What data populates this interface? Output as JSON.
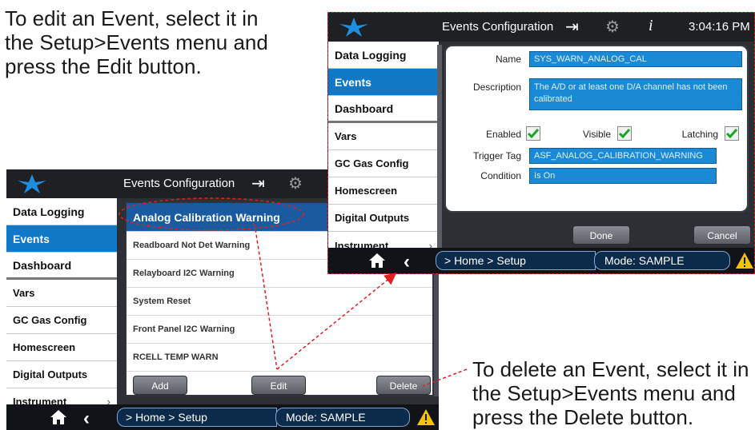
{
  "captions": {
    "edit": [
      "To edit an Event, select it in",
      "the Setup>Events menu and",
      "press the Edit button."
    ],
    "delete": [
      "To delete an Event, select it in",
      "the Setup>Events menu and",
      "press the Delete button."
    ]
  },
  "colors": {
    "accent": "#1178c8",
    "selected_row": "#1a5aa0",
    "field": "#1b8ad6",
    "annotation": "#e02020"
  },
  "left_screen": {
    "title": "Events Configuration",
    "sidebar": [
      "Data Logging",
      "Events",
      "Dashboard",
      "Vars",
      "GC Gas Config",
      "Homescreen",
      "Digital Outputs",
      "Instrument"
    ],
    "events": [
      "Analog Calibration Warning",
      "Readboard Not Det Warning",
      "Relayboard I2C Warning",
      "System Reset",
      "Front Panel I2C Warning",
      "RCELL TEMP WARN"
    ],
    "buttons": {
      "add": "Add",
      "edit": "Edit",
      "delete": "Delete"
    },
    "breadcrumb": "> Home > Setup",
    "mode": "Mode: SAMPLE"
  },
  "right_screen": {
    "title": "Events Configuration",
    "time": "3:04:16 PM",
    "sidebar": [
      "Data Logging",
      "Events",
      "Dashboard",
      "Vars",
      "GC Gas Config",
      "Homescreen",
      "Digital Outputs",
      "Instrument"
    ],
    "form": {
      "name_label": "Name",
      "name_value": "SYS_WARN_ANALOG_CAL",
      "description_label": "Description",
      "description_value": "The A/D or at least one D/A channel has not been calibrated",
      "enabled_label": "Enabled",
      "visible_label": "Visible",
      "latching_label": "Latching",
      "enabled": true,
      "visible": true,
      "latching": true,
      "trigger_label": "Trigger Tag",
      "trigger_value": "ASF_ANALOG_CALIBRATION_WARNING",
      "condition_label": "Condition",
      "condition_value": "Is On"
    },
    "buttons": {
      "done": "Done",
      "cancel": "Cancel"
    },
    "breadcrumb": "> Home > Setup",
    "mode": "Mode: SAMPLE"
  }
}
